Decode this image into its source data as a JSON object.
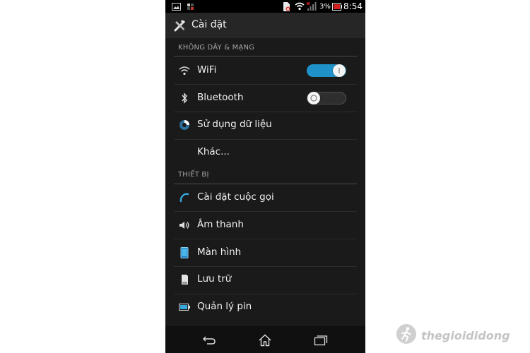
{
  "status_bar": {
    "battery_percent": "3%",
    "time": "8:54"
  },
  "action_bar": {
    "title": "Cài đặt",
    "icon": "tools-icon"
  },
  "sections": [
    {
      "header": "KHÔNG DÂY & MẠNG",
      "items": [
        {
          "label": "WiFi",
          "icon": "wifi-icon",
          "toggle": "on"
        },
        {
          "label": "Bluetooth",
          "icon": "bluetooth-icon",
          "toggle": "off"
        },
        {
          "label": "Sử dụng dữ liệu",
          "icon": "data-usage-icon"
        },
        {
          "label": "Khác...",
          "icon": null
        }
      ]
    },
    {
      "header": "THIẾT BỊ",
      "items": [
        {
          "label": "Cài đặt cuộc gọi",
          "icon": "phone-icon"
        },
        {
          "label": "Âm thanh",
          "icon": "speaker-icon"
        },
        {
          "label": "Màn hình",
          "icon": "display-icon"
        },
        {
          "label": "Lưu trữ",
          "icon": "storage-icon"
        },
        {
          "label": "Quản lý pin",
          "icon": "battery-icon"
        }
      ]
    }
  ],
  "nav_bar": {
    "buttons": [
      "back-icon",
      "home-icon",
      "recent-apps-icon"
    ]
  },
  "watermark": {
    "text": "thegioididong"
  },
  "colors": {
    "accent": "#1f93c9",
    "background": "#1a1a1a",
    "action_bar": "#262626",
    "section_header": "#a6a6a6"
  }
}
